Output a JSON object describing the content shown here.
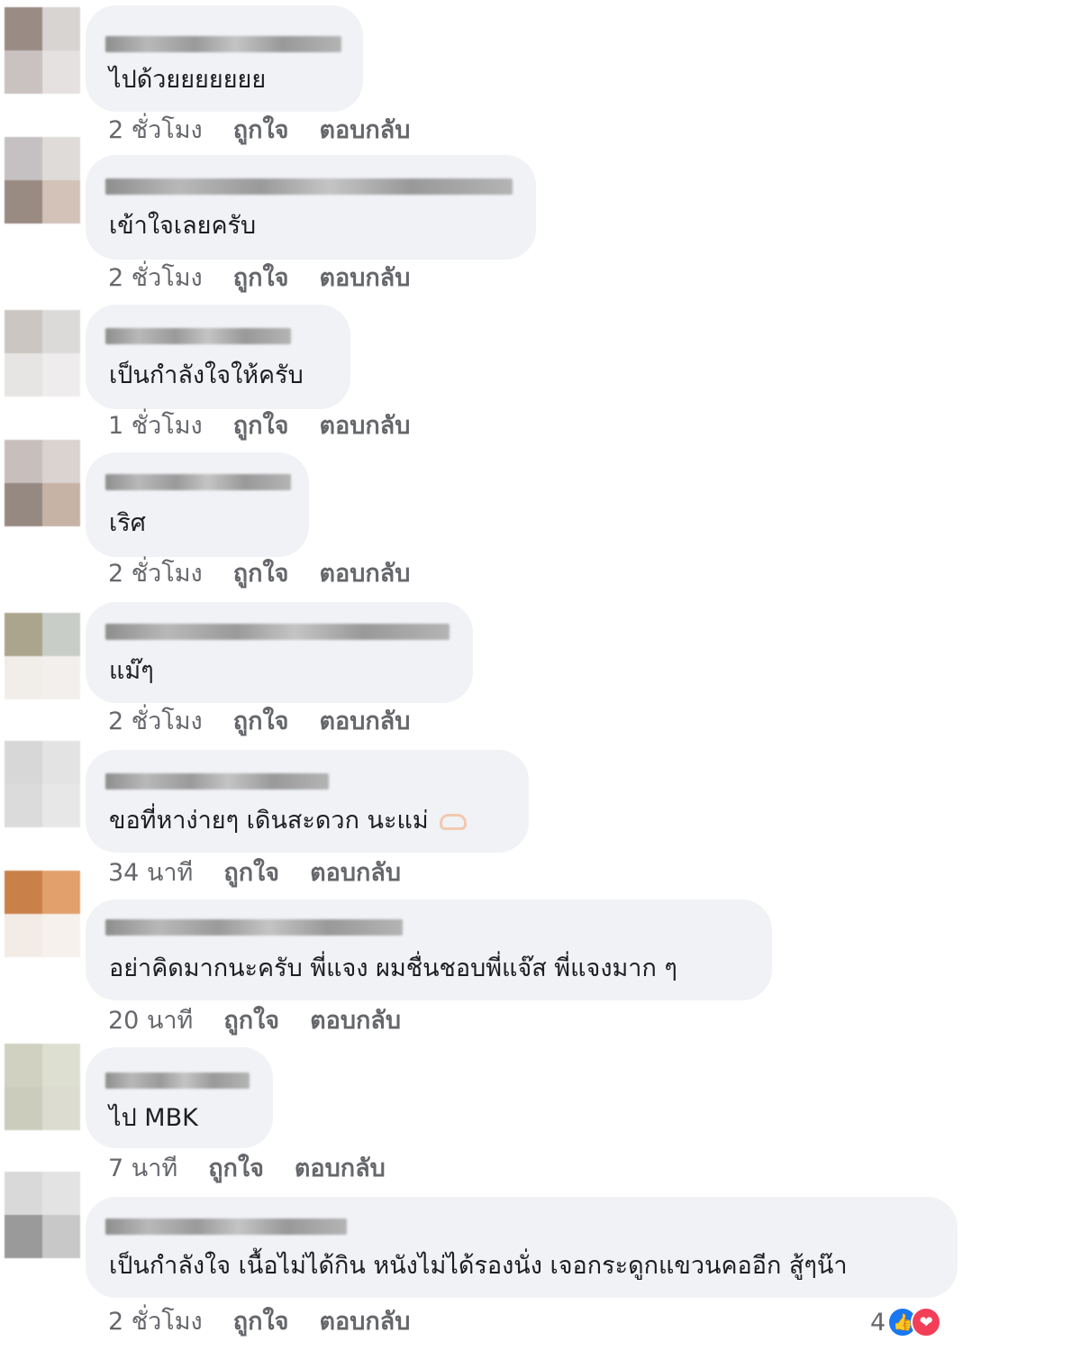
{
  "actions": {
    "like": "ถูกใจ",
    "reply": "ตอบกลับ"
  },
  "comments": [
    {
      "text": "ไปด้วยยยยยยย",
      "time": "2 ชั่วโมง",
      "avatar_colors": [
        "#9a8b85",
        "#d8d4d2",
        "#c9c2c0",
        "#e5e1e0"
      ]
    },
    {
      "text": "เข้าใจเลยครับ",
      "time": "2 ชั่วโมง",
      "avatar_colors": [
        "#c5c1c2",
        "#dedbd9",
        "#998a82",
        "#d2c2b8"
      ]
    },
    {
      "text": "เป็นกำลังใจให้ครับ",
      "time": "1 ชั่วโมง",
      "avatar_colors": [
        "#cbc6c2",
        "#dcdad8",
        "#e7e5e3",
        "#eeecec"
      ]
    },
    {
      "text": "เริศ",
      "time": "2 ชั่วโมง",
      "avatar_colors": [
        "#c8bfbd",
        "#dad3cf",
        "#968982",
        "#c7b2a6"
      ]
    },
    {
      "text": "แม๊ๆ",
      "time": "2 ชั่วโมง",
      "avatar_colors": [
        "#aca58e",
        "#c9cdc8",
        "#f1ede9",
        "#f3efed"
      ]
    },
    {
      "text": "ขอที่หาง่ายๆ เดินสะดวก นะแม่",
      "time": "34 นาที",
      "avatar_colors": [
        "#d8d7d7",
        "#e4e3e3",
        "#dcdbdb",
        "#e8e7e7"
      ]
    },
    {
      "text": "อย่าคิดมากนะครับ พี่แจง ผมชื่นชอบพี่แจ๊ส พี่แจงมาก ๆ",
      "time": "20 นาที",
      "avatar_colors": [
        "#c98149",
        "#e2a06d",
        "#f2ebe6",
        "#f6f1ed"
      ]
    },
    {
      "text": "ไป MBK",
      "time": "7 นาที",
      "avatar_colors": [
        "#d0d1c0",
        "#dddfd1",
        "#ccccbd",
        "#dcdcd0"
      ]
    },
    {
      "text": "เป็นกำลังใจ เนื้อไม่ได้กิน หนังไม่ได้รองนั่ง เจอกระดูกแขวนคออีก สู้ๆน๊า",
      "time": "2 ชั่วโมง",
      "avatar_colors": [
        "#d9d9d9",
        "#e3e3e3",
        "#9a9a9a",
        "#c8c8c8"
      ]
    }
  ],
  "reactions": {
    "count": "4",
    "types": [
      "like-icon",
      "love-icon"
    ],
    "colors": {
      "like": "#1877f2",
      "love": "#f33e58"
    }
  },
  "theme": {
    "bubble": "#f0f2f5",
    "meta_text": "#65676b",
    "text": "#1c1e21"
  }
}
